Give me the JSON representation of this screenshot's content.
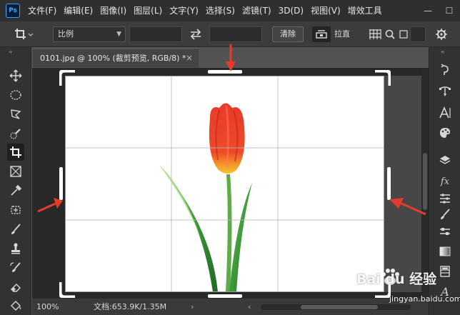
{
  "app": {
    "logo_text": "Ps",
    "menu": [
      "文件(F)",
      "编辑(E)",
      "图像(I)",
      "图层(L)",
      "文字(Y)",
      "选择(S)",
      "滤镜(T)",
      "3D(D)",
      "视图(V)",
      "增效工具"
    ],
    "window_controls": [
      "—",
      "☐"
    ]
  },
  "options_bar": {
    "tool_icon": "crop-icon",
    "ratio_value": "比例",
    "width_value": "",
    "height_value": "",
    "swap_icon": "swap-arrows-icon",
    "clear_label": "清除",
    "straighten_icon": "straighten-level-icon",
    "straighten_label": "拉直",
    "grid_icon": "grid-overlay-icon",
    "settings_icon": "gear-icon"
  },
  "document": {
    "tab_title": "0101.jpg @ 100% (裁剪预览, RGB/8) *",
    "close_symbol": "×"
  },
  "status_bar": {
    "zoom": "100%",
    "doc_size": "文档:653.9K/1.35M",
    "arrow_symbol": "›",
    "scroll_left_symbol": "‹"
  },
  "left_tools": [
    "move-icon",
    "elliptical-marquee-icon",
    "lasso-icon",
    "quick-selection-icon",
    "crop-icon",
    "frame-icon",
    "eyedropper-icon",
    "spot-healing-icon",
    "brush-icon",
    "clone-stamp-icon",
    "history-brush-icon",
    "eraser-icon",
    "paint-bucket-icon"
  ],
  "right_tools": [
    "history-panel-icon",
    "paths-icon",
    "character-icon",
    "color-palette-icon",
    "layers-icon",
    "fx-icon",
    "adjustments-icon",
    "brush-settings-icon",
    "properties-icon",
    "gradient-icon",
    "swatches-icon",
    "glyphs-icon"
  ],
  "colors": {
    "arrow_red": "#e53b2c",
    "tulip_red": "#e8402a",
    "stem_green": "#3f9a3a"
  },
  "watermark": {
    "line1": "Bai du 经验",
    "line2": "jingyan.baidu.com"
  }
}
